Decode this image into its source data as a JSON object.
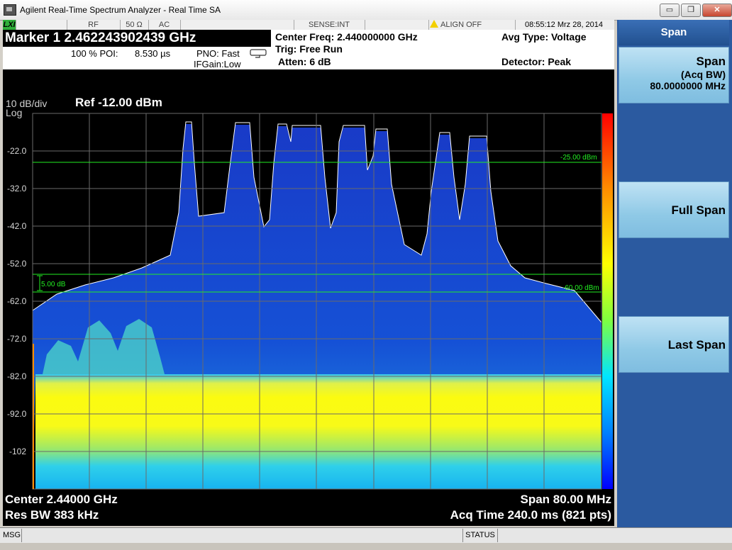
{
  "window": {
    "title": "Agilent Real-Time Spectrum Analyzer - Real Time SA",
    "minimize": "▭",
    "restore": "❐",
    "close": "✕"
  },
  "statusbar": {
    "lxi": "LXI",
    "rf": "RF",
    "impedance": "50 Ω",
    "coupling": "AC",
    "sense": "SENSE:INT",
    "align": "ALIGN OFF",
    "datetime": "08:55:12  Mrz 28, 2014"
  },
  "marker": {
    "title": "Marker 1  2.462243902439 GHz",
    "poi_label": "100 % POI:",
    "poi_value": "8.530 µs",
    "pno": "PNO: Fast",
    "ifgain": "IFGain:Low"
  },
  "settings": {
    "center_freq": "Center Freq: 2.440000000 GHz",
    "trig": "Trig: Free Run",
    "atten": "Atten: 6 dB",
    "avg_type": "Avg Type: Voltage",
    "detector": "Detector: Peak"
  },
  "plot": {
    "scale": "10 dB/div",
    "scale_type": "Log",
    "ref": "Ref -12.00 dBm",
    "y_ticks": [
      "-22.0",
      "-32.0",
      "-42.0",
      "-52.0",
      "-62.0",
      "-72.0",
      "-82.0",
      "-92.0",
      "-102"
    ],
    "threshold_upper": "-25.00 dBm",
    "threshold_lower": "-60.00 dBm",
    "db_marker": "5.00 dB",
    "center": "Center 2.44000 GHz",
    "res_bw": "Res BW  383 kHz",
    "span": "Span 80.00 MHz",
    "acq_time": "Acq Time  240.0 ms (821 pts)"
  },
  "softkeys": {
    "header": "Span",
    "span_title": "Span",
    "span_sub": "(Acq BW)",
    "span_value": "80.0000000 MHz",
    "full_span": "Full Span",
    "last_span": "Last Span"
  },
  "bottom": {
    "msg": "MSG",
    "status": "STATUS"
  },
  "colors": {
    "background": "#000000",
    "graticule": "#555555",
    "threshold": "#00ff00",
    "trace": "#ffffff",
    "softkey_panel": "#2b5aa0"
  }
}
